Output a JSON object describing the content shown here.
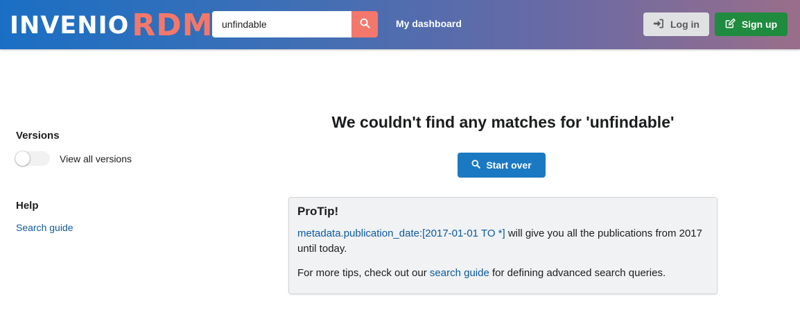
{
  "header": {
    "logo_primary": "INVENIO",
    "logo_secondary": "RDM",
    "search": {
      "value": "unfindable",
      "placeholder": ""
    },
    "nav_dashboard": "My dashboard",
    "login_label": "Log in",
    "signup_label": "Sign up"
  },
  "sidebar": {
    "versions_title": "Versions",
    "view_all_label": "View all versions",
    "view_all_enabled": false,
    "help_title": "Help",
    "search_guide_label": "Search guide"
  },
  "main": {
    "title": "We couldn't find any matches for 'unfindable'",
    "start_over_label": "Start over",
    "protip": {
      "title": "ProTip!",
      "example_query": "metadata.publication_date:[2017-01-01 TO *]",
      "example_text": " will give you all the publications from 2017 until today.",
      "more_prefix": "For more tips, check out our ",
      "more_link": "search guide",
      "more_suffix": " for defining advanced search queries."
    }
  },
  "colors": {
    "header_gradient_start": "#1a6fc4",
    "header_gradient_end": "#9a6e8a",
    "accent_search_button": "#f3786b",
    "logo_rdm": "#f4786a",
    "signup_button": "#1f8b3e",
    "start_over_button": "#1a79c2",
    "link": "#0c5aa0"
  },
  "icons": {
    "search_button": "search-icon",
    "login": "sign-in-icon",
    "signup": "edit-icon",
    "start_over": "search-icon"
  }
}
